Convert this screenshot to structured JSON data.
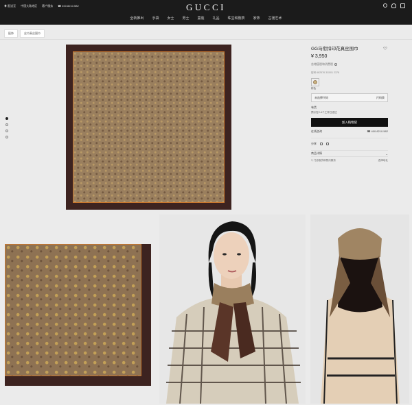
{
  "header": {
    "utility": [
      "◉ 配送至",
      "中国大陆地区",
      "客户服务",
      "☎ 400.8210.582"
    ],
    "logo": "GUCCI",
    "nav": [
      "全新推出",
      "手袋",
      "女士",
      "男士",
      "童装",
      "礼品",
      "珠宝和腕表",
      "家饰",
      "古驰艺术"
    ]
  },
  "breadcrumb": [
    "配饰",
    "丝巾真丝围巾"
  ],
  "product": {
    "title": "GG马衔扣印花真丝围巾",
    "price": "¥ 3,950",
    "origin": "含增值税和消费税",
    "sku": "型号 682576 3G001 2378",
    "swatch_label": "棕色",
    "size_label": "未选择尺码",
    "size_value": "尺码表",
    "availability": "有货",
    "availability_sub": "预计在2-4个工作日送达",
    "add_to_bag": "加入购物袋",
    "contact_label": "在线咨询",
    "contact_phone": "☎ 400.8210.582",
    "share_label": "分享",
    "details_label": "商品详情",
    "pickup_label": "⚲ 门店取货和预约服务",
    "pickup_link": "选择地址"
  },
  "colors": {
    "header_bg": "#1b1b1b",
    "page_bg": "#ebebeb",
    "scarf_border": "#3d2320",
    "scarf_gold": "#c9782f"
  }
}
